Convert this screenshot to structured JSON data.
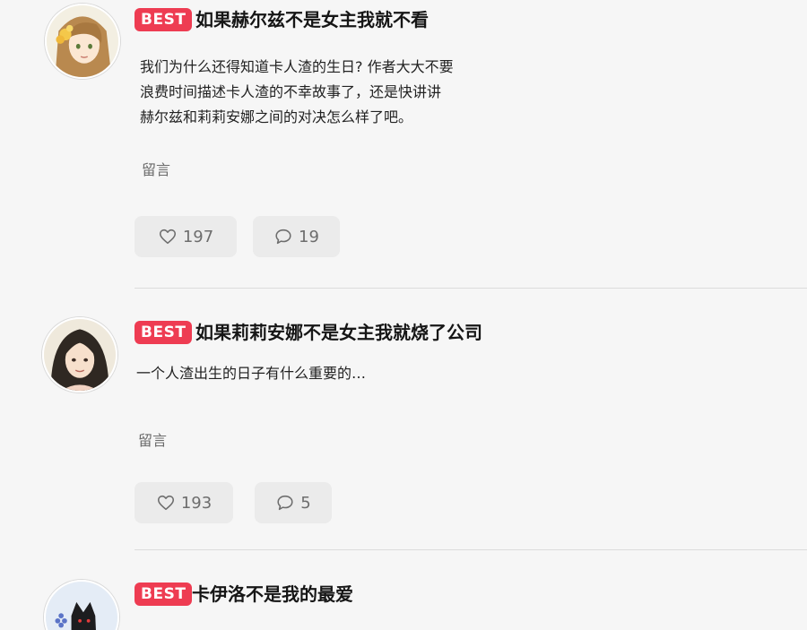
{
  "badge_label": "BEST",
  "reply_label": "留言",
  "comments": [
    {
      "username": "如果赫尔兹不是女主我就不看",
      "content_lines": [
        "我们为什么还得知道卡人渣的生日? 作者大大不要",
        "浪费时间描述卡人渣的不幸故事了，还是快讲讲",
        "赫尔兹和莉莉安娜之间的对决怎么样了吧。"
      ],
      "likes": "197",
      "replies": "19",
      "avatar_icon": "girl-flower-hair-avatar"
    },
    {
      "username": "如果莉莉安娜不是女主我就烧了公司",
      "content_lines": [
        "一个人渣出生的日子有什么重要的…"
      ],
      "likes": "193",
      "replies": "5",
      "avatar_icon": "dark-hair-woman-avatar"
    },
    {
      "username": "卡伊洛不是我的最爱",
      "content_lines": [],
      "avatar_icon": "black-cat-avatar"
    }
  ],
  "colors": {
    "badge": "#ee3c52",
    "background": "#f6f6f6",
    "button_bg": "#ebebeb",
    "divider": "#dcdcdc"
  }
}
